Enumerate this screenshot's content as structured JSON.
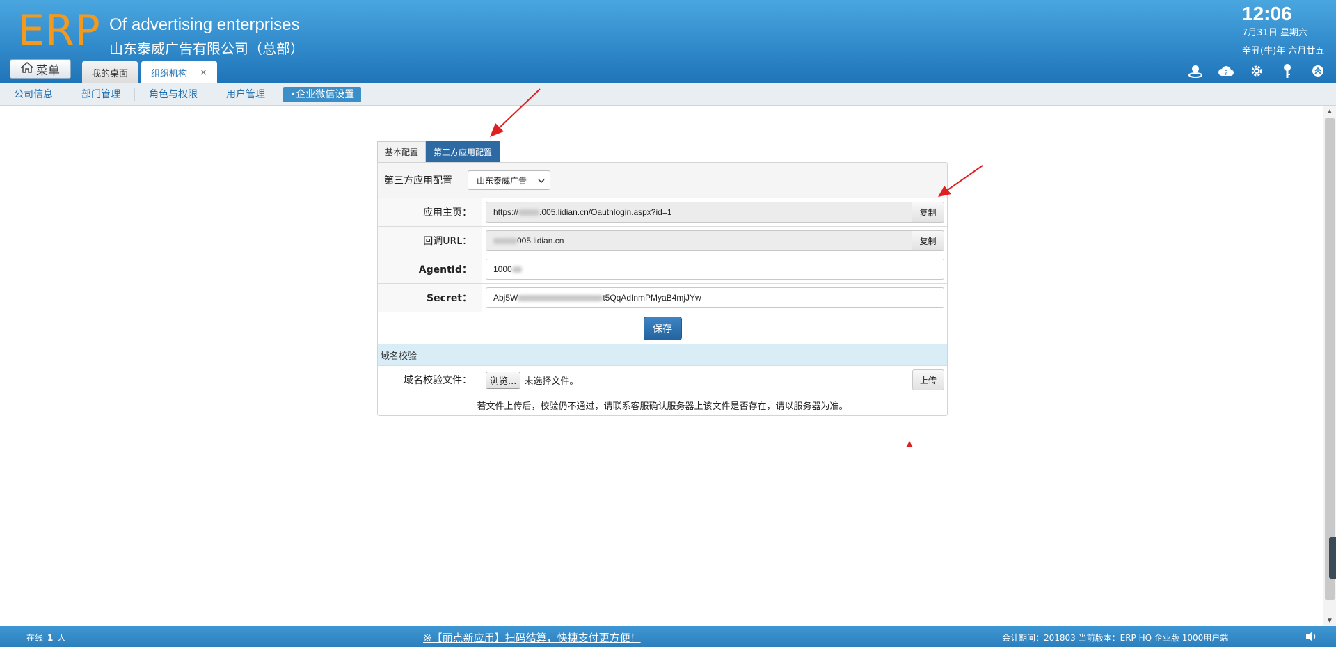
{
  "header": {
    "logo": "ERP",
    "brand_en": "Of advertising enterprises",
    "brand_cn": "山东泰威广告有限公司（总部）",
    "time": "12:06",
    "date": "7月31日 星期六",
    "lunar": "辛丑(牛)年 六月廿五",
    "menu_label": "菜单",
    "tabs": [
      {
        "label": "我的桌面"
      },
      {
        "label": "组织机构",
        "close": "×"
      }
    ]
  },
  "subnav": {
    "items": [
      {
        "label": "公司信息"
      },
      {
        "label": "部门管理"
      },
      {
        "label": "角色与权限"
      },
      {
        "label": "用户管理"
      },
      {
        "label": "•企业微信设置"
      }
    ]
  },
  "panel": {
    "tabs": [
      {
        "label": "基本配置"
      },
      {
        "label": "第三方应用配置"
      }
    ],
    "config_label": "第三方应用配置",
    "select_value": "山东泰威广告",
    "fields": [
      {
        "label": "应用主页：",
        "value_start": "https://",
        "value_end": ".005.lidian.cn/Oauthlogin.aspx?id=1",
        "button": "复制"
      },
      {
        "label": "回调URL：",
        "value_start": "",
        "value_end": "005.lidian.cn",
        "button": "复制"
      },
      {
        "label": "AgentId：",
        "value_start": "1000",
        "value_end": ""
      },
      {
        "label": "Secret：",
        "value_start": "Abj5W",
        "value_end": "t5QqAdInmPMyaB4mjJYw"
      }
    ],
    "save_label": "保存",
    "domain_section": "域名校验",
    "domain_file_label": "域名校验文件：",
    "browse_label": "浏览...",
    "no_file": "未选择文件。",
    "upload_label": "上传",
    "note": "若文件上传后，校验仍不通过，请联系客服确认服务器上该文件是否存在，请以服务器为准。"
  },
  "footer": {
    "online_prefix": "在线",
    "online_count": "1",
    "online_suffix": "人",
    "promo": "※【丽点新应用】扫码结算，快捷支付更方便！",
    "version": "会计期间：201803 当前版本：ERP HQ 企业版 1000用户端"
  },
  "colors": {
    "header_blue": "#2f88c9",
    "logo_orange": "#f39a1e",
    "active_tab": "#2d6aa3",
    "annotation_red": "#e02020"
  }
}
